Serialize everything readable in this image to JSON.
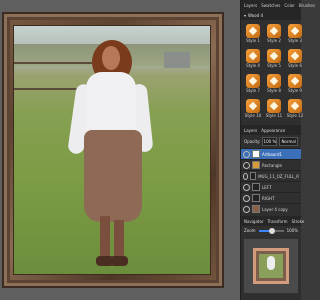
{
  "panel": {
    "tabs": [
      "Layers",
      "Swatches",
      "Color",
      "Brushes"
    ],
    "styles_header": "Wood 4",
    "styles": [
      {
        "label": "Style 1"
      },
      {
        "label": "Style 2"
      },
      {
        "label": "Style 3"
      },
      {
        "label": "Style 4"
      },
      {
        "label": "Style 5"
      },
      {
        "label": "Style 6"
      },
      {
        "label": "Style 7"
      },
      {
        "label": "Style 8"
      },
      {
        "label": "Style 9"
      },
      {
        "label": "Style 10"
      },
      {
        "label": "Style 11"
      },
      {
        "label": "Style 12"
      }
    ],
    "layers_tabs": [
      "Layers",
      "Appearance"
    ],
    "opacity_label": "Opacity:",
    "opacity_value": "100 %",
    "blend_mode": "Normal",
    "layers": [
      {
        "name": "Artboard1",
        "selected": true,
        "thumb": "white"
      },
      {
        "name": "Rectangle",
        "selected": false,
        "thumb": "orange"
      },
      {
        "name": "MUG_11_OZ_FULL_R",
        "selected": false,
        "thumb": "dark"
      },
      {
        "name": "LEFT",
        "selected": false,
        "thumb": "dark"
      },
      {
        "name": "RIGHT",
        "selected": false,
        "thumb": "dark"
      },
      {
        "name": "Layer 4 copy",
        "selected": false,
        "thumb": "brown"
      }
    ],
    "navigator_tabs": [
      "Navigator",
      "Transform",
      "Stroke"
    ],
    "zoom_label": "Zoom",
    "zoom_value": "100%",
    "zoom_fraction": 0.4
  }
}
